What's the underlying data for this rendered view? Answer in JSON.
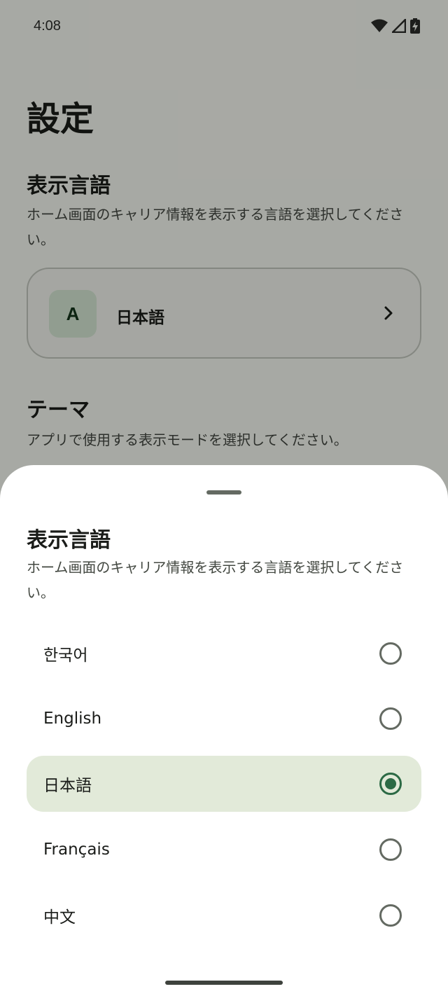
{
  "status_bar": {
    "time": "4:08",
    "icons": [
      "wifi-icon",
      "cellular-signal-icon",
      "battery-charging-icon"
    ]
  },
  "page": {
    "title": "設定",
    "language_section": {
      "title": "表示言語",
      "description": "ホーム画面のキャリア情報を表示する言語を選択してください。",
      "card": {
        "avatar_letter": "A",
        "current_language": "日本語",
        "chevron_icon": "chevron-right-icon"
      }
    },
    "theme_section": {
      "title": "テーマ",
      "description": "アプリで使用する表示モードを選択してください。"
    }
  },
  "sheet": {
    "title": "表示言語",
    "description": "ホーム画面のキャリア情報を表示する言語を選択してください。",
    "options": [
      {
        "label": "한국어",
        "selected": false
      },
      {
        "label": "English",
        "selected": false
      },
      {
        "label": "日本語",
        "selected": true
      },
      {
        "label": "Français",
        "selected": false
      },
      {
        "label": "中文",
        "selected": false
      }
    ]
  },
  "colors": {
    "accent": "#2c6a45",
    "selected_row": "#e2ead9",
    "avatar_bg": "#d6e8d4",
    "scrim": "rgba(0,0,0,0.32)"
  }
}
